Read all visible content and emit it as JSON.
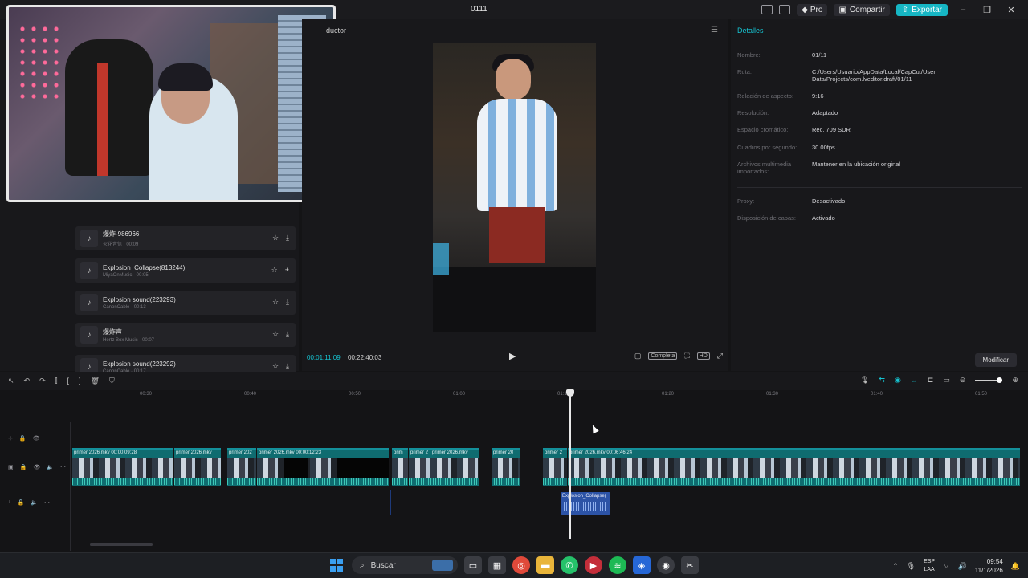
{
  "titlebar": {
    "title": "0111",
    "pro_label": "Pro",
    "share_label": "Compartir",
    "export_label": "Exportar"
  },
  "player": {
    "title": "ductor",
    "time_current": "00:01:11:09",
    "time_total": "00:22:40:03",
    "ratio_label": "Completa"
  },
  "sounds": [
    {
      "title": "爆炸-986966",
      "sub": "火花音信 · 00:09",
      "action": "download"
    },
    {
      "title": "Explosion_Collapse(813244)",
      "sub": "MiyaOnMusic · 00:05",
      "action": "add"
    },
    {
      "title": "Explosion sound(223293)",
      "sub": "CanonCable · 00:13",
      "action": "download"
    },
    {
      "title": "爆炸声",
      "sub": "Hertz Box Music · 00:07",
      "action": "download"
    },
    {
      "title": "Explosion sound(223292)",
      "sub": "CanonCable · 00:17",
      "action": "download"
    }
  ],
  "details": {
    "title": "Detalles",
    "rows": [
      {
        "label": "Nombre:",
        "value": "01/11"
      },
      {
        "label": "Ruta:",
        "value": "C:/Users/Usuario/AppData/Local/CapCut/User Data/Projects/com.lveditor.draft/01/11"
      },
      {
        "label": "Relación de aspecto:",
        "value": "9:16"
      },
      {
        "label": "Resolución:",
        "value": "Adaptado"
      },
      {
        "label": "Espacio cromático:",
        "value": "Rec. 709 SDR"
      },
      {
        "label": "Cuadros por segundo:",
        "value": "30.00fps"
      },
      {
        "label": "Archivos multimedia importados:",
        "value": "Mantener en la ubicación original"
      },
      {
        "label": "Proxy:",
        "value": "Desactivado"
      },
      {
        "label": "Disposición de capas:",
        "value": "Activado"
      }
    ],
    "modify_label": "Modificar"
  },
  "timeline": {
    "ticks": [
      "00:30",
      "00:40",
      "00:50",
      "01:00",
      "01:10",
      "01:20",
      "01:30",
      "01:40",
      "01:50"
    ],
    "clips": [
      {
        "label": "primer 2026.mkv    00:00:09:28"
      },
      {
        "label": "primer 2026.mkv"
      },
      {
        "label": "primer 202"
      },
      {
        "label": "primer 2026.mkv    00:00:12:23"
      },
      {
        "label": "prim"
      },
      {
        "label": "primer 2"
      },
      {
        "label": "primer 2026.mkv"
      },
      {
        "label": "primer 20"
      },
      {
        "label": "primer 2"
      },
      {
        "label": "primer 2026.mkv    00:06:46:24"
      }
    ],
    "audio_clip_label": "Explosion_Collapse("
  },
  "taskbar": {
    "search_label": "Buscar",
    "lang_1": "ESP",
    "lang_2": "LAA",
    "time": "09:54",
    "date": "11/1/2026"
  }
}
